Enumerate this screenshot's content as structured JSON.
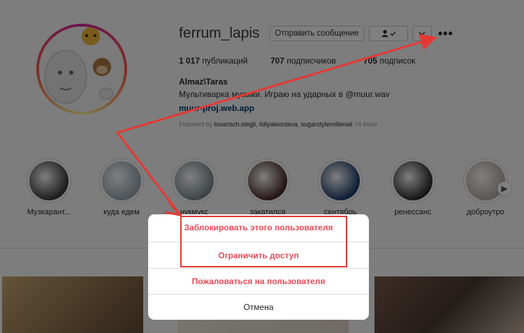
{
  "profile": {
    "username": "ferrum_lapis",
    "message_button": "Отправить сообщение",
    "follow_button_icon": "user-check-icon",
    "suggest_button_icon": "chevron-down-icon",
    "more_icon": "more-dots-icon",
    "more_label": "•••",
    "stats": {
      "posts_count": "1 017",
      "posts_label": "публикаций",
      "followers_count": "707",
      "followers_label": "подписчиков",
      "following_count": "705",
      "following_label": "подписок"
    },
    "full_name": "Almaz\\Taras",
    "bio": "Мультиварка музыки. Играю на ударных в @muur.wav",
    "link": "muur-proj.web.app",
    "followed_by_prefix": "Followed by",
    "followed_by_names": "tovarisch.idegli, lidiyaleonteva, sugarstylemillenial",
    "followed_by_more": "+4 more"
  },
  "highlights": [
    {
      "label": "Музкарант...",
      "color": "#3a3a3a"
    },
    {
      "label": "куда едем",
      "color": "#9aa7b0"
    },
    {
      "label": "нукмукс",
      "color": "#7d8a8c"
    },
    {
      "label": "закатился",
      "color": "#4a2a2a"
    },
    {
      "label": "сентябрь",
      "color": "#1e3d6b"
    },
    {
      "label": "ренессанс",
      "color": "#2b2b2b"
    },
    {
      "label": "доброутро",
      "color": "#b3aea6"
    }
  ],
  "modal": {
    "block": "Заблокировать этого пользователя",
    "restrict": "Ограничить доступ",
    "report": "Пожаловаться на пользователя",
    "cancel": "Отмена"
  },
  "colors": {
    "danger": "#ed4956",
    "annotation": "#e53935",
    "link": "#00376b"
  }
}
